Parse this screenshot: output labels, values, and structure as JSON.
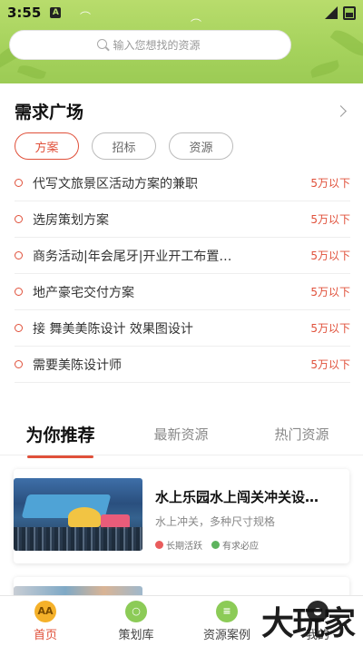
{
  "status": {
    "time": "3:55",
    "notif_letter": "A"
  },
  "search": {
    "placeholder": "输入您想找的资源"
  },
  "demand": {
    "title": "需求广场",
    "filters": [
      "方案",
      "招标",
      "资源"
    ],
    "items": [
      {
        "text": "代写文旅景区活动方案的兼职",
        "price": "5万以下"
      },
      {
        "text": "选房策划方案",
        "price": "5万以下"
      },
      {
        "text": "商务活动|年会尾牙|开业开工布置…",
        "price": "5万以下"
      },
      {
        "text": "地产豪宅交付方案",
        "price": "5万以下"
      },
      {
        "text": "接 舞美美陈设计 效果图设计",
        "price": "5万以下"
      },
      {
        "text": "需要美陈设计师",
        "price": "5万以下"
      }
    ]
  },
  "recommend": {
    "tabs": [
      "为你推荐",
      "最新资源",
      "热门资源"
    ],
    "cards": [
      {
        "title": "水上乐园水上闯关冲关设…",
        "subtitle": "水上冲关，多种尺寸规格",
        "tags": [
          "长期活跃",
          "有求必应"
        ]
      }
    ]
  },
  "nav": {
    "items": [
      {
        "label": "首页",
        "icon": "home-icon"
      },
      {
        "label": "策划库",
        "icon": "library-icon"
      },
      {
        "label": "资源案例",
        "icon": "case-icon"
      },
      {
        "label": "我的",
        "icon": "profile-icon"
      }
    ]
  },
  "watermark": "大玩家",
  "colors": {
    "accent": "#e0503a",
    "header_green": "#a5d25c",
    "home_icon": "#f5b12a"
  }
}
